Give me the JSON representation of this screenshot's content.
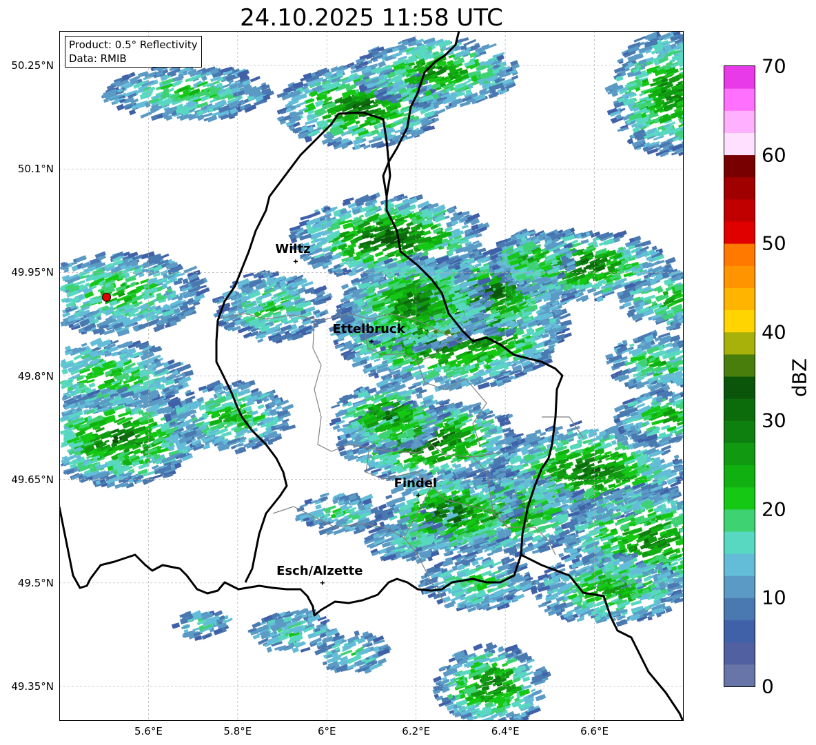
{
  "title": "24.10.2025 11:58 UTC",
  "info": {
    "product": "Product: 0.5° Reflectivity",
    "data": "Data: RMIB"
  },
  "map": {
    "lon_range": [
      5.4,
      6.8
    ],
    "lat_range": [
      49.3,
      50.3
    ],
    "lat_ticks": [
      "50.25°N",
      "50.1°N",
      "49.95°N",
      "49.8°N",
      "49.65°N",
      "49.5°N",
      "49.35°N"
    ],
    "lon_ticks": [
      "5.6°E",
      "5.8°E",
      "6°E",
      "6.2°E",
      "6.4°E",
      "6.6°E"
    ],
    "grid": true,
    "cities": [
      {
        "name": "Wiltz",
        "lon": 5.93,
        "lat": 49.966
      },
      {
        "name": "Ettelbruck",
        "lon": 6.1,
        "lat": 49.85
      },
      {
        "name": "Findel",
        "lon": 6.205,
        "lat": 49.627
      },
      {
        "name": "Esch/Alzette",
        "lon": 5.99,
        "lat": 49.5
      }
    ],
    "radar_site": {
      "lon": 5.506,
      "lat": 49.914
    }
  },
  "colorbar": {
    "label": "dBZ",
    "ticks": [
      "0",
      "10",
      "20",
      "30",
      "40",
      "50",
      "60",
      "70"
    ],
    "colors": [
      "#6775a8",
      "#5060a0",
      "#4060a8",
      "#4a78b0",
      "#5a9ac5",
      "#63bcd8",
      "#58d8c0",
      "#3ed272",
      "#14c814",
      "#10b010",
      "#119911",
      "#0e8010",
      "#0c6c0c",
      "#0b550b",
      "#4a7e0c",
      "#a8b00a",
      "#ffd400",
      "#ffb400",
      "#ff9400",
      "#ff7800",
      "#e00000",
      "#c00000",
      "#a00000",
      "#780000",
      "#ffe0ff",
      "#ffb0ff",
      "#ff70ff",
      "#e83ae8"
    ]
  },
  "colors": {
    "border": "#000000",
    "cantons": "#808080",
    "grid": "#b0b0b0",
    "radar_marker": "#e00000"
  }
}
